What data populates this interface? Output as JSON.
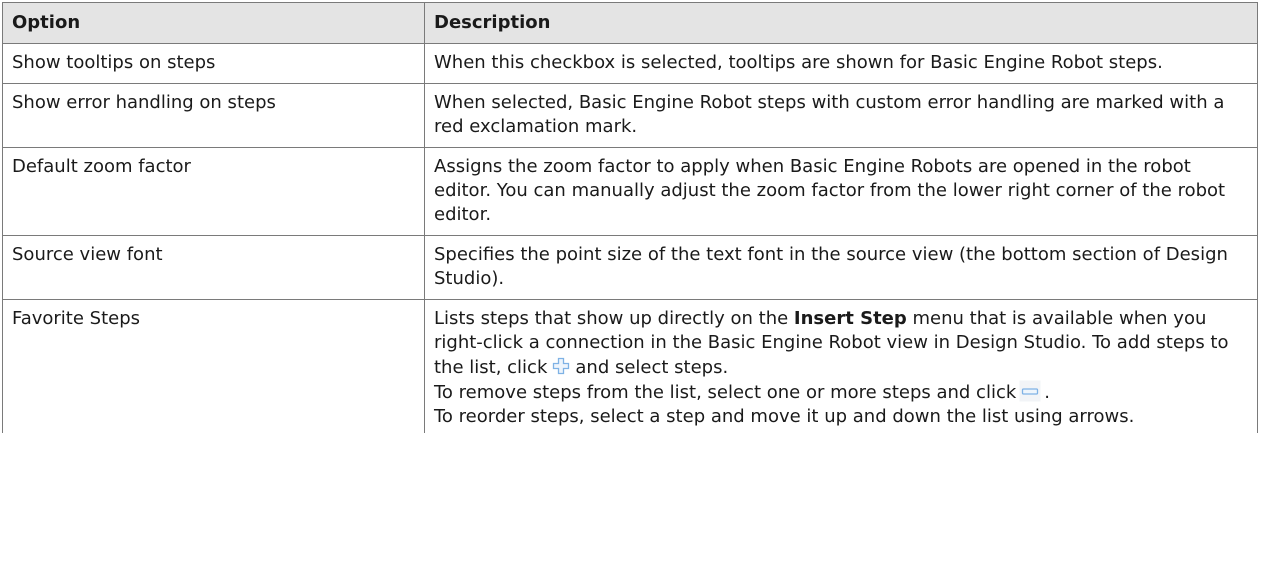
{
  "table": {
    "headers": [
      "Option",
      "Description"
    ],
    "rows": [
      {
        "option": "Show tooltips on steps",
        "description": "When this checkbox is selected, tooltips are shown for Basic Engine Robot steps."
      },
      {
        "option": "Show error handling on steps",
        "description": "When selected, Basic Engine Robot steps with custom error handling are marked with a red exclamation mark."
      },
      {
        "option": "Default zoom factor",
        "description": "Assigns the zoom factor to apply when Basic Engine Robots are opened in the robot editor. You can manually adjust the zoom factor from the lower right corner of the robot editor."
      },
      {
        "option": "Source view font",
        "description": "Specifies the point size of the text font in the source view (the bottom section of Design Studio)."
      },
      {
        "option": "Favorite Steps",
        "description_parts": {
          "p1_before_bold": "Lists steps that show up directly on the ",
          "p1_bold": "Insert Step",
          "p1_after_bold": " menu that is available when you right-click a connection in the Basic Engine Robot view in Design Studio. To add steps to the list, click",
          "p1_end": "and select steps.",
          "p2_start": "To remove steps from the list, select one or more steps and click",
          "p2_end": ".",
          "p3": "To reorder steps, select a step and move it up and down the list using arrows."
        },
        "icons": {
          "add": "add-plus-icon",
          "remove": "remove-minus-icon"
        }
      }
    ]
  },
  "colors": {
    "header_bg": "#e4e4e4",
    "border": "#7a7a7a",
    "icon_blue": "#7fb2e5",
    "icon_bg": "#eef3f9"
  }
}
